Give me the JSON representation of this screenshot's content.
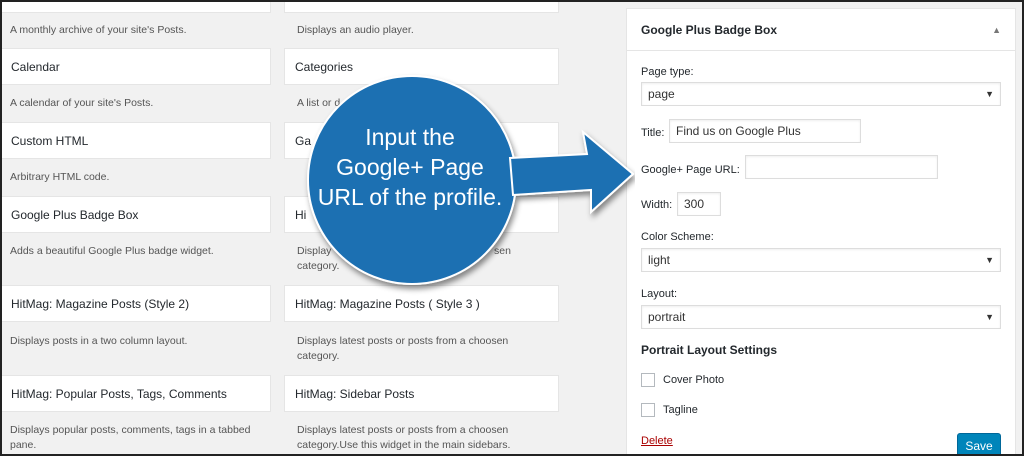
{
  "widgets": [
    {
      "title": "",
      "desc": "A monthly archive of your site's Posts."
    },
    {
      "title": "",
      "desc": "Displays an audio player."
    },
    {
      "title": "Calendar",
      "desc": "A calendar of your site's Posts."
    },
    {
      "title": "Categories",
      "desc": "A list or d"
    },
    {
      "title": "Custom HTML",
      "desc": "Arbitrary HTML code."
    },
    {
      "title": "Ga",
      "desc": ""
    },
    {
      "title": "Google Plus Badge Box",
      "desc": "Adds a beautiful Google Plus badge widget."
    },
    {
      "title": "Hi",
      "desc": "Display",
      "desc2": "category.",
      "desc_right": "sen"
    },
    {
      "title": "HitMag: Magazine Posts (Style 2)",
      "desc": "Displays posts in a two column layout."
    },
    {
      "title": "HitMag: Magazine Posts ( Style 3 )",
      "desc": "Displays latest posts or posts from a choosen",
      "desc2": "category."
    },
    {
      "title": "HitMag: Popular Posts, Tags, Comments",
      "desc": "Displays popular posts, comments, tags in a tabbed",
      "desc2": "pane."
    },
    {
      "title": "HitMag: Sidebar Posts",
      "desc": "Displays latest posts or posts from a choosen",
      "desc2": "category.Use this widget in the main sidebars."
    }
  ],
  "panel": {
    "title": "Google Plus Badge Box",
    "page_type_label": "Page type:",
    "page_type_value": "page",
    "title_label": "Title:",
    "title_value": "Find us on Google Plus",
    "url_label": "Google+ Page URL:",
    "url_value": "",
    "width_label": "Width:",
    "width_value": "300",
    "color_label": "Color Scheme:",
    "color_value": "light",
    "layout_label": "Layout:",
    "layout_value": "portrait",
    "portrait_section": "Portrait Layout Settings",
    "cover_photo_label": "Cover Photo",
    "tagline_label": "Tagline",
    "delete_label": "Delete",
    "save_label": "Save"
  },
  "callout": {
    "line1": "Input the",
    "line2": "Google+ Page",
    "line3": "URL of the profile."
  },
  "colors": {
    "callout_blue": "#1f6fb2",
    "save_blue": "#0085ba",
    "delete_red": "#a00"
  }
}
